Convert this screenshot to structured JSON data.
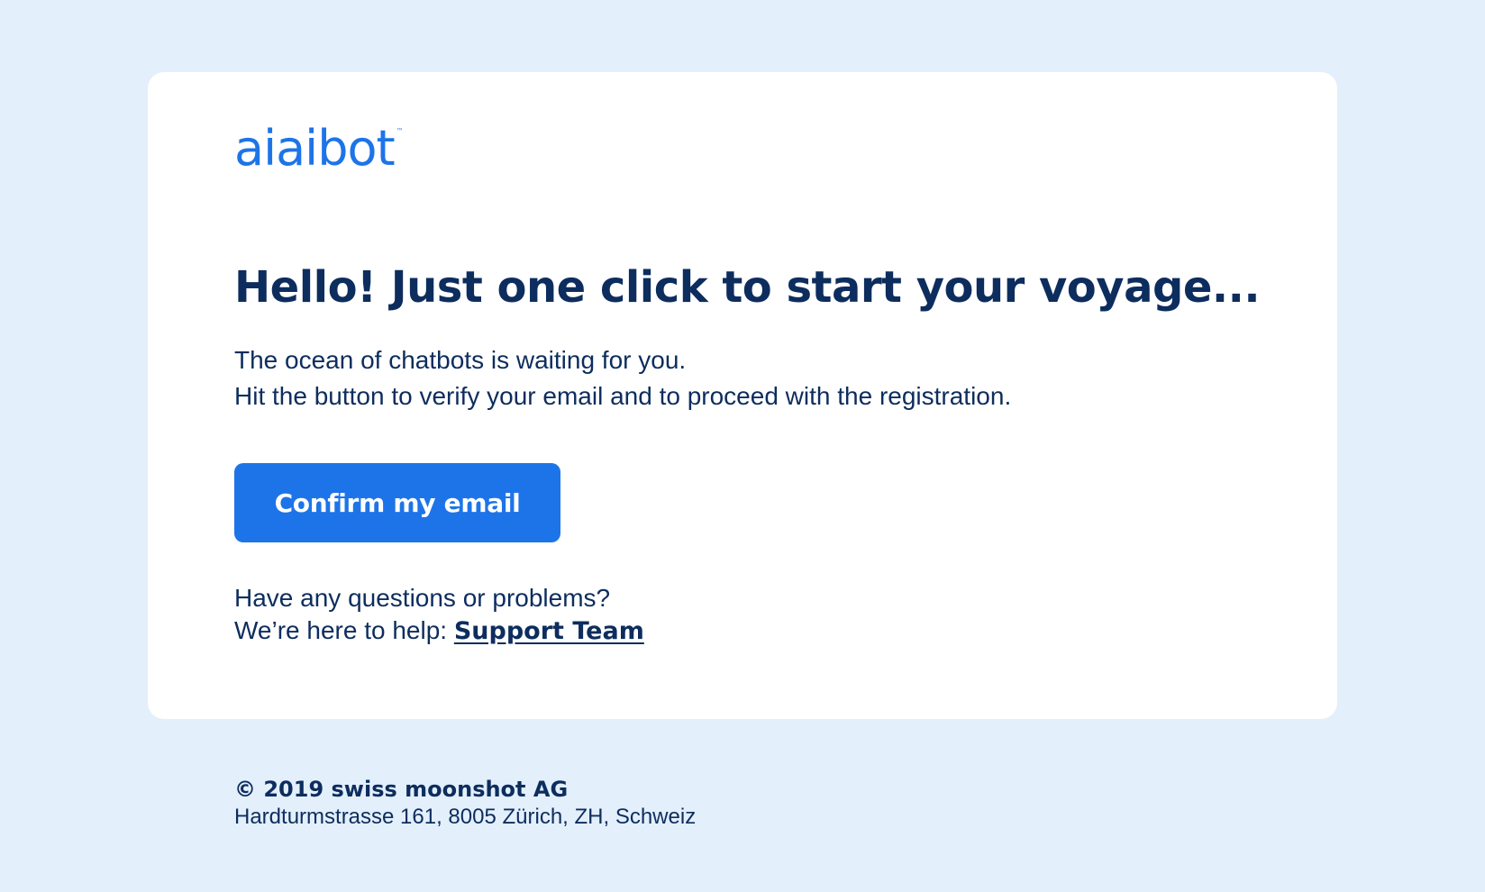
{
  "brand": {
    "logo_text": "aiaibot",
    "logo_trademark": "™",
    "accent_color": "#1d74e8",
    "text_color": "#0d2d5e",
    "background_color": "#e3effb"
  },
  "email": {
    "headline": "Hello! Just one click to start your voyage...",
    "intro_line_1": "The ocean of chatbots is waiting for you.",
    "intro_line_2": "Hit the button to verify your email and to proceed with the registration.",
    "confirm_button_label": "Confirm my email",
    "help_line_1": "Have any questions or problems?",
    "help_line_2_prefix": "We’re here to help:",
    "support_link_label": "Support Team"
  },
  "footer": {
    "copyright": "© 2019 swiss moonshot AG",
    "address": "Hardturmstrasse 161, 8005 Zürich, ZH, Schweiz"
  }
}
